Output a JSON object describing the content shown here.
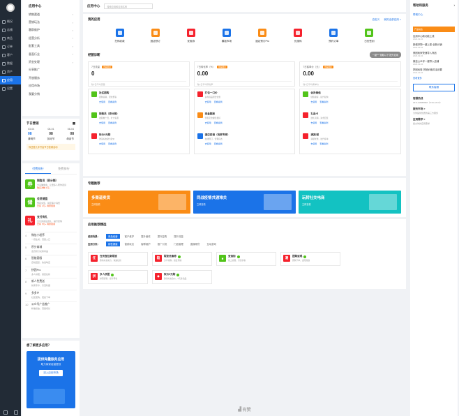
{
  "nav": {
    "items": [
      "概况",
      "店铺",
      "商品",
      "订单",
      "客户",
      "数据",
      "资产",
      "应用",
      "设置"
    ],
    "active_index": 7
  },
  "side": {
    "title": "应用中心",
    "menu": [
      {
        "label": "销售渠道",
        "arrow": true
      },
      {
        "label": "营销玩法",
        "arrow": true
      },
      {
        "label": "客群维护",
        "arrow": true
      },
      {
        "label": "经营分析",
        "arrow": true
      },
      {
        "label": "配套工具",
        "arrow": true
      },
      {
        "label": "垂直行业",
        "arrow": true
      },
      {
        "label": "资金处理",
        "arrow": true
      },
      {
        "label": "分享推广",
        "arrow": false
      },
      {
        "label": "开放服务",
        "arrow": false
      },
      {
        "label": "应用市场",
        "arrow": false
      },
      {
        "label": "我要分销",
        "arrow": false
      }
    ]
  },
  "calendar": {
    "title": "节日营销",
    "days": [
      "03-04",
      "08-01",
      "08-04"
    ],
    "nums": [
      "08",
      "08",
      "08"
    ],
    "events": [
      "清明节",
      "劳动节",
      "母亲节"
    ],
    "note": "你还差几步开启节日营销活动"
  },
  "rank": {
    "tabs": [
      "付费排行",
      "免费排行"
    ],
    "top": [
      {
        "icon": "券",
        "color": "#52c41a",
        "title": "销售员（原分销）",
        "desc": "分享赚佣金，让更多人帮你卖货",
        "tag": "购买次数 1万+"
      },
      {
        "icon": "储",
        "color": "#52c41a",
        "title": "会员储值",
        "desc": "预存充值，锁定客户消费",
        "tag": "已有 1万+ 商家使用"
      },
      {
        "icon": "礼",
        "color": "#f5222d",
        "title": "支付有礼",
        "desc": "支付完成后送礼，提升复购",
        "tag": "已有 5万+ 商家使用"
      }
    ],
    "items": [
      {
        "n": "4",
        "title": "微信小程序",
        "desc": "一键生成，流量入口"
      },
      {
        "n": "5",
        "title": "积分商城",
        "desc": "会员积分兑换商品"
      },
      {
        "n": "6",
        "title": "智能客服",
        "desc": "自动回复，快速响应"
      },
      {
        "n": "7",
        "title": "拼团Pro",
        "desc": "多人拼团，裂变拉新"
      },
      {
        "n": "8",
        "title": "新人免费送",
        "desc": "新客专享，引流利器"
      },
      {
        "n": "9",
        "title": "多多乡",
        "desc": "社区团购，便捷下单"
      },
      {
        "n": "10",
        "title": "公众号广告推广",
        "desc": "精准投放，流量增长"
      }
    ]
  },
  "promo": {
    "title": "想了解更多应用？",
    "line1": "提供海量服务应用",
    "line2": "助力商家经营提效",
    "button": "进入应用市场"
  },
  "topbar": {
    "title": "应用中心",
    "search_placeholder": "搜索应用和应用名称"
  },
  "my_apps": {
    "title": "我的应用",
    "links": [
      "自定义",
      "我的全部应用 >"
    ],
    "apps": [
      {
        "label": "扫码收款",
        "color": "#1b73e8"
      },
      {
        "label": "酒店预订",
        "color": "#fa8c16"
      },
      {
        "label": "优惠券",
        "color": "#f5222d"
      },
      {
        "label": "模板市场",
        "color": "#1b73e8"
      },
      {
        "label": "酒店预订Pro",
        "color": "#fa8c16"
      },
      {
        "label": "优惠码",
        "color": "#f5222d"
      },
      {
        "label": "预约订单",
        "color": "#1b73e8"
      },
      {
        "label": "日历签到",
        "color": "#52c41a"
      }
    ]
  },
  "summary": {
    "title": "经营诊断",
    "button": "一键*** 领取以下 提升应用",
    "stats": [
      {
        "label": "7日流量",
        "badge": "查看图片",
        "value": "0",
        "cmp": "较7日平均流量"
      },
      {
        "label": "7日转化率（%）",
        "badge": "查看图片",
        "value": "0.00",
        "cmp": "较7日平均转化率"
      },
      {
        "label": "7日客单价（元）",
        "badge": "查看图片",
        "value": "0.00",
        "cmp": "较7日平均客单价"
      }
    ],
    "tools": [
      [
        {
          "name": "社区团购",
          "desc": "团购营销，轻松聚客",
          "color": "#52c41a"
        },
        {
          "name": "销售员（原分销）",
          "desc": "发展推广员，扩大客源",
          "color": "#52c41a"
        },
        {
          "name": "砍价0元购",
          "desc": "邀请好友助力砍价",
          "color": "#f5222d"
        }
      ],
      [
        {
          "name": "打包一口价",
          "desc": "多件商品组合优惠",
          "color": "#f5222d"
        },
        {
          "name": "定金膨胀",
          "desc": "预售定金翻倍抵扣",
          "color": "#fa8c16"
        },
        {
          "name": "酒店民宿（商家专享）",
          "desc": "在线预订，管理房态",
          "color": "#1b73e8"
        }
      ],
      [
        {
          "name": "会员储值",
          "desc": "储值锁客，提升复购",
          "color": "#52c41a"
        },
        {
          "name": "礼品卡",
          "desc": "送礼营销，资金回笼",
          "color": "#f5222d"
        },
        {
          "name": "满减/送",
          "desc": "满额优惠，拉升客单",
          "color": "#f5222d"
        }
      ]
    ],
    "link_use": "去使用",
    "link_case": "查看案例"
  },
  "special": {
    "title": "专题推荐",
    "banners": [
      {
        "title": "多渠道卖货",
        "sub": "立即查看",
        "color": "#fa8c16"
      },
      {
        "title": "同战疫情共渡难关",
        "sub": "立即查看",
        "color": "#1b73e8"
      },
      {
        "title": "玩转社交电商",
        "sub": "立即查看",
        "color": "#13c2c2"
      }
    ]
  },
  "recommend": {
    "title": "应用推荐精选",
    "row1_label": "使用场景：",
    "row1": [
      "商品经营",
      "客户维护",
      "提升营收",
      "提升复购",
      "提升流量"
    ],
    "row2_label": "应用分类：",
    "row2": [
      "销售渠道",
      "营销玩法",
      "客群维护",
      "推广引流",
      "门店管理",
      "直播带货",
      "互动游戏"
    ],
    "items": [
      {
        "icon": "任",
        "color": "#f5222d",
        "name": "任务宝拉新裂变",
        "desc": "邀请好友助力，快速拉新",
        "verified": false
      },
      {
        "icon": "裂",
        "color": "#f5222d",
        "name": "裂变优惠券",
        "desc": "分享领券，裂变传播",
        "verified": true
      },
      {
        "icon": "■",
        "color": "#52c41a",
        "name": "爱逛街",
        "desc": "线上商圈，引流获客",
        "verified": true
      },
      {
        "icon": "潮",
        "color": "#f5222d",
        "name": "团购返现",
        "desc": "团购下单，返现激励",
        "verified": true
      },
      {
        "icon": "拼",
        "color": "#f5222d",
        "name": "多人拼团",
        "desc": "拼团营销，提升转化",
        "verified": true
      },
      {
        "icon": "◆",
        "color": "#f5222d",
        "name": "砍价0元购",
        "desc": "邀请好友砍价，0元拿商品",
        "verified": true
      }
    ]
  },
  "footer": "有赞",
  "right": {
    "title": "帮助和服务",
    "help": "帮助中心",
    "banner": "产品动态",
    "news": [
      {
        "t": "应用中心新功能上线",
        "d": "2020-02-04"
      },
      {
        "t": "新增好物一键上架·全新分销",
        "d": "2020-02-04"
      },
      {
        "t": "美团卖家快速导入商品",
        "d": "2020-02-04"
      },
      {
        "t": "微信公众号一键导入店铺",
        "d": "2020-02-04"
      },
      {
        "t": "拼团优惠·拼团价格灵活设置",
        "d": "2020-02-04"
      }
    ],
    "more": "查看更多",
    "service_btn": "联系客服",
    "info": [
      {
        "t": "客服热线",
        "v": "0571-88888888（8:30-18:00）"
      },
      {
        "t": "服务市场 >",
        "v": "为你提供优质的第三方服务"
      },
      {
        "t": "应用需求 >",
        "v": "提交你的应用需求"
      }
    ]
  }
}
